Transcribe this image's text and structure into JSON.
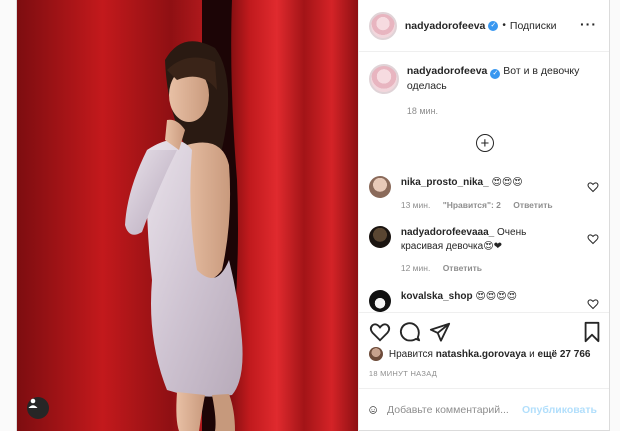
{
  "post": {
    "author": "nadyadorofeeva",
    "follow_label": "Подписки",
    "dot": "•",
    "more_label": "···",
    "verified_glyph": "✓",
    "caption": {
      "username": "nadyadorofeeva",
      "text": "Вот и в девочку оделась",
      "time": "18 мин."
    },
    "load_more_label": "+"
  },
  "comments": [
    {
      "username": "nika_prosto_nika_",
      "text": "😍😍😍",
      "time": "13 мин.",
      "likes": "\"Нравится\": 2",
      "reply": "Ответить"
    },
    {
      "username": "nadyadorofeevaaa_",
      "text": "Очень красивая девочка😍❤",
      "time": "12 мин.",
      "reply": "Ответить"
    },
    {
      "username": "kovalska_shop",
      "text": "😍😍😍😍"
    }
  ],
  "likes_line": {
    "prefix": "Нравится",
    "user": "natashka.gorovaya",
    "middle": "и",
    "rest": "ещё 27 766"
  },
  "timestamp": "18 МИНУТ НАЗАД",
  "add_comment": {
    "placeholder": "Добавьте комментарий...",
    "publish_label": "Опубликовать"
  },
  "icons": {
    "tag": "user-tag-icon",
    "more": "more-options-icon",
    "like": "heart-icon",
    "comment": "comment-icon",
    "share": "share-icon",
    "save": "bookmark-icon",
    "emoji": "emoji-icon",
    "load_more": "plus-circle-icon"
  },
  "colors": {
    "verified": "#3897f0",
    "publish_disabled": "#b2dffc",
    "muted": "#8e8e8e"
  }
}
